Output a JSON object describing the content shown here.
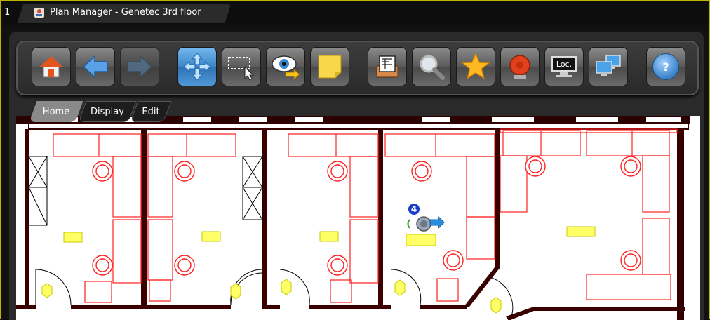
{
  "window": {
    "tab_number": "1",
    "title": "Plan Manager - Genetec 3rd floor"
  },
  "toolbar": {
    "buttons": [
      {
        "name": "home",
        "icon": "home-icon",
        "state": "normal"
      },
      {
        "name": "back",
        "icon": "arrow-left-icon",
        "state": "normal"
      },
      {
        "name": "forward",
        "icon": "arrow-right-icon",
        "state": "disabled"
      },
      {
        "name": "pan",
        "icon": "move-icon",
        "state": "active"
      },
      {
        "name": "select",
        "icon": "selection-icon",
        "state": "normal"
      },
      {
        "name": "view",
        "icon": "eye-icon",
        "state": "normal"
      },
      {
        "name": "note",
        "icon": "sticky-note-icon",
        "state": "normal"
      },
      {
        "name": "layers",
        "icon": "layers-icon",
        "state": "normal"
      },
      {
        "name": "search",
        "icon": "magnifier-icon",
        "state": "normal"
      },
      {
        "name": "favorites",
        "icon": "star-icon",
        "state": "normal"
      },
      {
        "name": "alarm",
        "icon": "alarm-bell-icon",
        "state": "normal"
      },
      {
        "name": "location",
        "icon": "monitor-icon",
        "label": "Loc.",
        "state": "normal"
      },
      {
        "name": "network",
        "icon": "computers-icon",
        "state": "normal"
      },
      {
        "name": "help",
        "icon": "help-icon",
        "label": "?",
        "state": "normal"
      }
    ]
  },
  "subtabs": [
    {
      "label": "Home",
      "selected": true
    },
    {
      "label": "Display",
      "selected": false
    },
    {
      "label": "Edit",
      "selected": false
    }
  ],
  "map": {
    "camera_badge": "4"
  },
  "colors": {
    "frame_border": "#b9b400",
    "wall": "#3a0000",
    "furniture": "#ff2020",
    "label_fill": "#ffff66",
    "active_button": "#3d86c9"
  }
}
